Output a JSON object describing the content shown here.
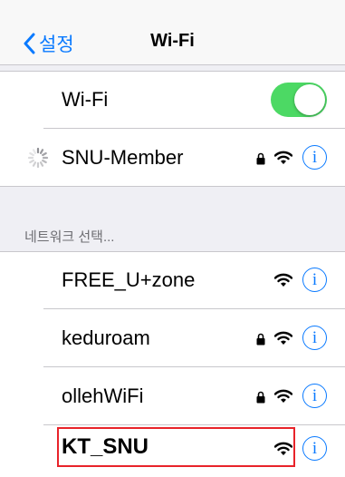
{
  "nav": {
    "back_label": "설정",
    "title": "Wi-Fi"
  },
  "wifi_toggle": {
    "label": "Wi-Fi",
    "on": true,
    "color": "#4cd964"
  },
  "current_network": {
    "name": "SNU-Member",
    "locked": true,
    "status_icon": "loading-spinner-icon"
  },
  "section_header": "네트워크 선택...",
  "networks": [
    {
      "name": "FREE_U+zone",
      "locked": false
    },
    {
      "name": "keduroam",
      "locked": true
    },
    {
      "name": "ollehWiFi",
      "locked": true
    },
    {
      "name": "KT_SNU",
      "locked": false
    }
  ],
  "info_glyph": "i",
  "colors": {
    "accent": "#0a7aff",
    "highlight": "#e8232a",
    "background": "#efeff4"
  }
}
